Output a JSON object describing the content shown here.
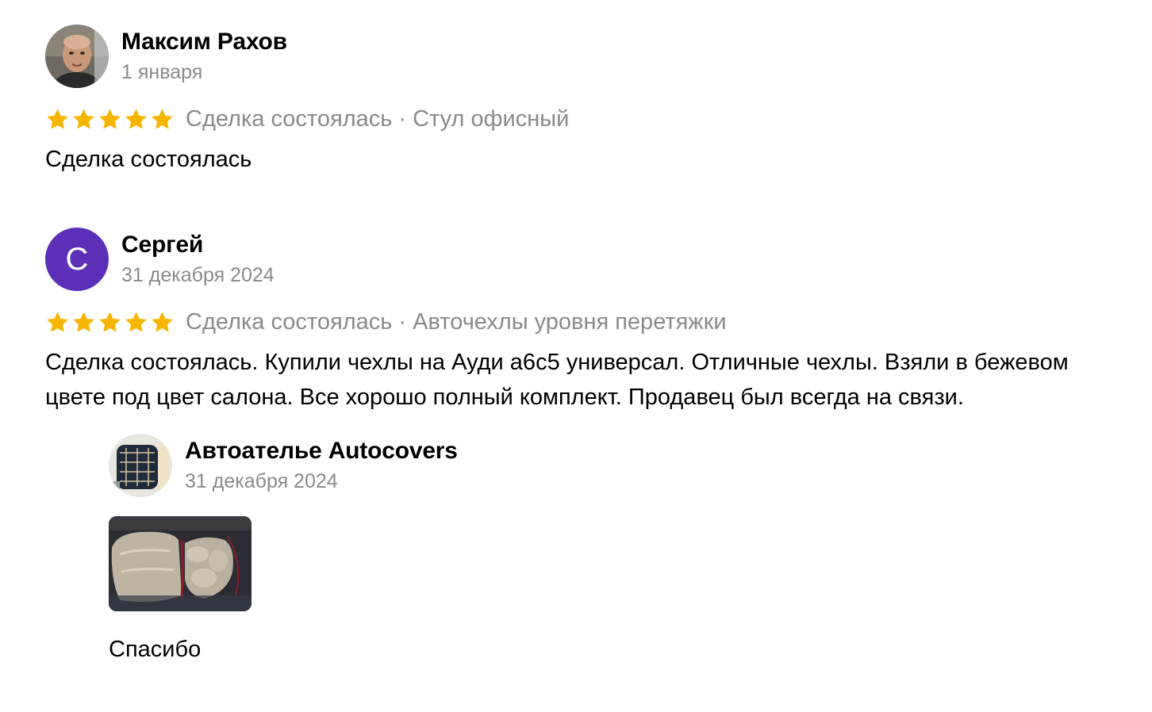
{
  "colors": {
    "star": "#f7b500",
    "muted_text": "#8a8a8a",
    "avatar_letter_bg": "#5b2fb8"
  },
  "reviews": [
    {
      "author": "Максим Рахов",
      "date": "1 января",
      "avatar_icon": "user-photo-icon",
      "rating": 5,
      "deal": "Сделка состоялась · Стул офисный",
      "text": "Сделка состоялась"
    },
    {
      "author": "Сергей",
      "date": "31 декабря 2024",
      "avatar_letter": "С",
      "rating": 5,
      "deal": "Сделка состоялась · Авточехлы уровня перетяжки",
      "text": "Сделка состоялась. Купили чехлы на Ауди а6с5 универсал. Отличные чехлы. Взяли в бежевом цвете под цвет салона. Все хорошо полный комплект. Продавец был всегда на связи.",
      "reply": {
        "author": "Автоателье Autocovers",
        "date": "31 декабря 2024",
        "avatar_icon": "shop-logo-icon",
        "photo_icon": "seat-covers-photo",
        "text": "Спасибо"
      }
    }
  ]
}
